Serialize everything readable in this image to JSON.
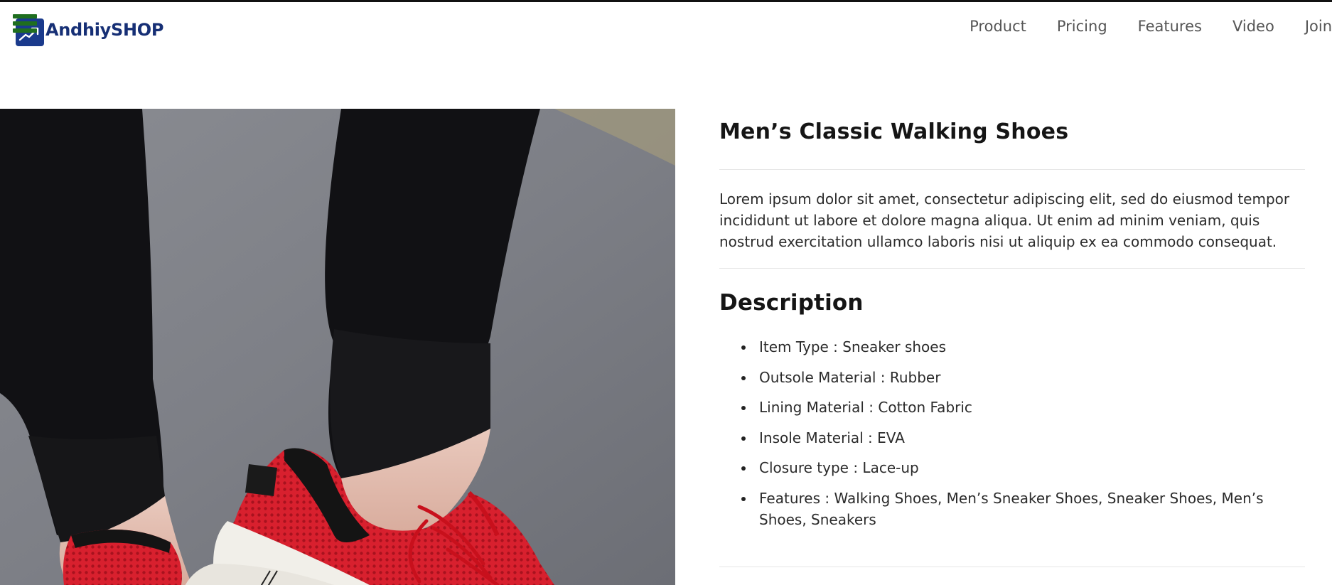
{
  "brand": {
    "name": "AndhiySHOP",
    "colors": {
      "logo_blue": "#1a3a8c",
      "logo_text": "#162f75",
      "menu_green": "#1f6e1f"
    }
  },
  "nav": {
    "items": [
      {
        "label": "Product"
      },
      {
        "label": "Pricing"
      },
      {
        "label": "Features"
      },
      {
        "label": "Video"
      },
      {
        "label": "Join"
      }
    ]
  },
  "hero": {
    "image_subject": "red knit sneaker with white sole on a foot, black jogger pants"
  },
  "product": {
    "title": "Men’s Classic Walking Shoes",
    "summary": "Lorem ipsum dolor sit amet, consectetur adipiscing elit, sed do eiusmod tempor incididunt ut labore et dolore magna aliqua. Ut enim ad minim veniam, quis nostrud exercitation ullamco laboris nisi ut aliquip ex ea commodo consequat.",
    "description_heading": "Description",
    "specs": [
      "Item Type : Sneaker shoes",
      "Outsole Material : Rubber",
      "Lining Material : Cotton Fabric",
      "Insole Material : EVA",
      "Closure type : Lace-up",
      "Features : Walking Shoes, Men’s Sneaker Shoes, Sneaker Shoes, Men’s Shoes, Sneakers"
    ]
  }
}
